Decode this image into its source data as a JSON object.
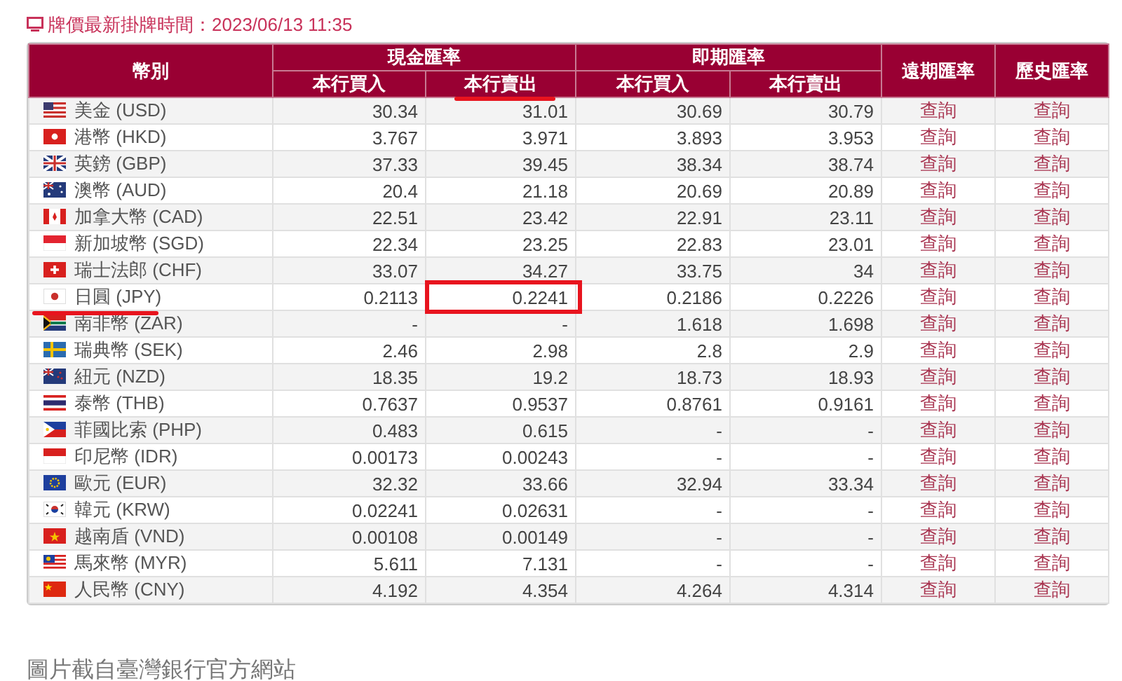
{
  "update_notice": "牌價最新掛牌時間：2023/06/13 11:35",
  "table": {
    "currency_header": "幣別",
    "groups": [
      {
        "label": "現金匯率",
        "columns": [
          {
            "label": "本行買入",
            "underlined": false
          },
          {
            "label": "本行賣出",
            "underlined": true
          }
        ]
      },
      {
        "label": "即期匯率",
        "columns": [
          {
            "label": "本行買入",
            "underlined": false
          },
          {
            "label": "本行賣出",
            "underlined": false
          }
        ]
      }
    ],
    "link_headers": [
      "遠期匯率",
      "歷史匯率"
    ],
    "rows": [
      {
        "kind": "us",
        "currency": "美金 (USD)",
        "cash_buy": "30.34",
        "cash_sell": "31.01",
        "spot_buy": "30.69",
        "spot_sell": "30.79",
        "forward": "查詢",
        "history": "查詢",
        "marked": false
      },
      {
        "kind": "hk",
        "currency": "港幣 (HKD)",
        "cash_buy": "3.767",
        "cash_sell": "3.971",
        "spot_buy": "3.893",
        "spot_sell": "3.953",
        "forward": "查詢",
        "history": "查詢",
        "marked": false
      },
      {
        "kind": "gb",
        "currency": "英鎊 (GBP)",
        "cash_buy": "37.33",
        "cash_sell": "39.45",
        "spot_buy": "38.34",
        "spot_sell": "38.74",
        "forward": "查詢",
        "history": "查詢",
        "marked": false
      },
      {
        "kind": "au",
        "currency": "澳幣 (AUD)",
        "cash_buy": "20.4",
        "cash_sell": "21.18",
        "spot_buy": "20.69",
        "spot_sell": "20.89",
        "forward": "查詢",
        "history": "查詢",
        "marked": false
      },
      {
        "kind": "ca",
        "currency": "加拿大幣 (CAD)",
        "cash_buy": "22.51",
        "cash_sell": "23.42",
        "spot_buy": "22.91",
        "spot_sell": "23.11",
        "forward": "查詢",
        "history": "查詢",
        "marked": false
      },
      {
        "kind": "sg",
        "currency": "新加坡幣 (SGD)",
        "cash_buy": "22.34",
        "cash_sell": "23.25",
        "spot_buy": "22.83",
        "spot_sell": "23.01",
        "forward": "查詢",
        "history": "查詢",
        "marked": false
      },
      {
        "kind": "ch",
        "currency": "瑞士法郎 (CHF)",
        "cash_buy": "33.07",
        "cash_sell": "34.27",
        "spot_buy": "33.75",
        "spot_sell": "34",
        "forward": "查詢",
        "history": "查詢",
        "marked": false
      },
      {
        "kind": "jp",
        "currency": "日圓 (JPY)",
        "cash_buy": "0.2113",
        "cash_sell": "0.2241",
        "spot_buy": "0.2186",
        "spot_sell": "0.2226",
        "forward": "查詢",
        "history": "查詢",
        "marked": true
      },
      {
        "kind": "za",
        "currency": "南非幣 (ZAR)",
        "cash_buy": "-",
        "cash_sell": "-",
        "spot_buy": "1.618",
        "spot_sell": "1.698",
        "forward": "查詢",
        "history": "查詢",
        "marked": false
      },
      {
        "kind": "se",
        "currency": "瑞典幣 (SEK)",
        "cash_buy": "2.46",
        "cash_sell": "2.98",
        "spot_buy": "2.8",
        "spot_sell": "2.9",
        "forward": "查詢",
        "history": "查詢",
        "marked": false
      },
      {
        "kind": "nz",
        "currency": "紐元 (NZD)",
        "cash_buy": "18.35",
        "cash_sell": "19.2",
        "spot_buy": "18.73",
        "spot_sell": "18.93",
        "forward": "查詢",
        "history": "查詢",
        "marked": false
      },
      {
        "kind": "th",
        "currency": "泰幣 (THB)",
        "cash_buy": "0.7637",
        "cash_sell": "0.9537",
        "spot_buy": "0.8761",
        "spot_sell": "0.9161",
        "forward": "查詢",
        "history": "查詢",
        "marked": false
      },
      {
        "kind": "ph",
        "currency": "菲國比索 (PHP)",
        "cash_buy": "0.483",
        "cash_sell": "0.615",
        "spot_buy": "-",
        "spot_sell": "-",
        "forward": "查詢",
        "history": "查詢",
        "marked": false
      },
      {
        "kind": "id",
        "currency": "印尼幣 (IDR)",
        "cash_buy": "0.00173",
        "cash_sell": "0.00243",
        "spot_buy": "-",
        "spot_sell": "-",
        "forward": "查詢",
        "history": "查詢",
        "marked": false
      },
      {
        "kind": "eu",
        "currency": "歐元 (EUR)",
        "cash_buy": "32.32",
        "cash_sell": "33.66",
        "spot_buy": "32.94",
        "spot_sell": "33.34",
        "forward": "查詢",
        "history": "查詢",
        "marked": false
      },
      {
        "kind": "kr",
        "currency": "韓元 (KRW)",
        "cash_buy": "0.02241",
        "cash_sell": "0.02631",
        "spot_buy": "-",
        "spot_sell": "-",
        "forward": "查詢",
        "history": "查詢",
        "marked": false
      },
      {
        "kind": "vn",
        "currency": "越南盾 (VND)",
        "cash_buy": "0.00108",
        "cash_sell": "0.00149",
        "spot_buy": "-",
        "spot_sell": "-",
        "forward": "查詢",
        "history": "查詢",
        "marked": false
      },
      {
        "kind": "my",
        "currency": "馬來幣 (MYR)",
        "cash_buy": "5.611",
        "cash_sell": "7.131",
        "spot_buy": "-",
        "spot_sell": "-",
        "forward": "查詢",
        "history": "查詢",
        "marked": false
      },
      {
        "kind": "cn",
        "currency": "人民幣 (CNY)",
        "cash_buy": "4.192",
        "cash_sell": "4.354",
        "spot_buy": "4.264",
        "spot_sell": "4.314",
        "forward": "查詢",
        "history": "查詢",
        "marked": false
      }
    ]
  },
  "caption": "圖片截自臺灣銀行官方網站"
}
